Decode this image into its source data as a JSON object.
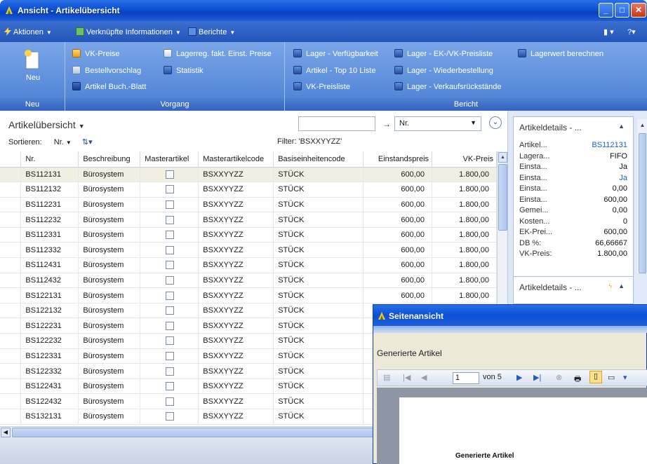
{
  "window": {
    "title": "Ansicht - Artikelübersicht",
    "minimize": "_",
    "maximize": "□",
    "close": "✕"
  },
  "commandbar": {
    "actions": "Aktionen",
    "related": "Verknüpfte Informationen",
    "reports": "Berichte"
  },
  "ribbon": {
    "groups": {
      "new": {
        "caption": "Neu",
        "items": {
          "new": "Neu"
        }
      },
      "process": {
        "caption": "Vorgang",
        "items": {
          "vk_preise": "VK-Preise",
          "bestellvorschlag": "Bestellvorschlag",
          "artikel_buch_blatt": "Artikel Buch.-Blatt",
          "lagerreg": "Lagerreg. fakt. Einst. Preise",
          "statistik": "Statistik"
        }
      },
      "report": {
        "caption": "Bericht",
        "items": {
          "lager_verfuegbarkeit": "Lager - Verfügbarkeit",
          "artikel_top10": "Artikel - Top 10 Liste",
          "vk_preisliste": "VK-Preisliste",
          "lager_ek_vk": "Lager - EK-/VK-Preisliste",
          "lager_wiederbestellung": "Lager - Wiederbestellung",
          "lager_verkaufsrueckstaende": "Lager - Verkaufsrückstände",
          "lagerwert": "Lagerwert berechnen"
        }
      }
    }
  },
  "list": {
    "title": "Artikelübersicht",
    "sort_label": "Sortieren:",
    "sort_value": "Nr.",
    "search_value": "",
    "search_field": "Nr.",
    "filter": "Filter: 'BSXXYYZZ'",
    "columns": [
      "Nr.",
      "Beschreibung",
      "Masterartikel",
      "Masterartikelcode",
      "Basiseinheitencode",
      "Einstandspreis",
      "VK-Preis"
    ],
    "rows": [
      [
        "BS112131",
        "Bürosystem",
        "",
        "BSXXYYZZ",
        "STÜCK",
        "600,00",
        "1.800,00"
      ],
      [
        "BS112132",
        "Bürosystem",
        "",
        "BSXXYYZZ",
        "STÜCK",
        "600,00",
        "1.800,00"
      ],
      [
        "BS112231",
        "Bürosystem",
        "",
        "BSXXYYZZ",
        "STÜCK",
        "600,00",
        "1.800,00"
      ],
      [
        "BS112232",
        "Bürosystem",
        "",
        "BSXXYYZZ",
        "STÜCK",
        "600,00",
        "1.800,00"
      ],
      [
        "BS112331",
        "Bürosystem",
        "",
        "BSXXYYZZ",
        "STÜCK",
        "600,00",
        "1.800,00"
      ],
      [
        "BS112332",
        "Bürosystem",
        "",
        "BSXXYYZZ",
        "STÜCK",
        "600,00",
        "1.800,00"
      ],
      [
        "BS112431",
        "Bürosystem",
        "",
        "BSXXYYZZ",
        "STÜCK",
        "600,00",
        "1.800,00"
      ],
      [
        "BS112432",
        "Bürosystem",
        "",
        "BSXXYYZZ",
        "STÜCK",
        "600,00",
        "1.800,00"
      ],
      [
        "BS122131",
        "Bürosystem",
        "",
        "BSXXYYZZ",
        "STÜCK",
        "600,00",
        "1.800,00"
      ],
      [
        "BS122132",
        "Bürosystem",
        "",
        "BSXXYYZZ",
        "STÜCK",
        "",
        ""
      ],
      [
        "BS122231",
        "Bürosystem",
        "",
        "BSXXYYZZ",
        "STÜCK",
        "",
        ""
      ],
      [
        "BS122232",
        "Bürosystem",
        "",
        "BSXXYYZZ",
        "STÜCK",
        "",
        ""
      ],
      [
        "BS122331",
        "Bürosystem",
        "",
        "BSXXYYZZ",
        "STÜCK",
        "",
        ""
      ],
      [
        "BS122332",
        "Bürosystem",
        "",
        "BSXXYYZZ",
        "STÜCK",
        "",
        ""
      ],
      [
        "BS122431",
        "Bürosystem",
        "",
        "BSXXYYZZ",
        "STÜCK",
        "",
        ""
      ],
      [
        "BS122432",
        "Bürosystem",
        "",
        "BSXXYYZZ",
        "STÜCK",
        "",
        ""
      ],
      [
        "BS132131",
        "Bürosystem",
        "",
        "BSXXYYZZ",
        "STÜCK",
        "",
        ""
      ]
    ]
  },
  "factbox1": {
    "title": "Artikeldetails - ...",
    "rows": [
      {
        "k": "Artikel...",
        "v": "BS112131",
        "link": true
      },
      {
        "k": "Lagera...",
        "v": "FIFO"
      },
      {
        "k": "Einsta...",
        "v": "Ja"
      },
      {
        "k": "Einsta...",
        "v": "Ja",
        "link": true
      },
      {
        "k": "Einsta...",
        "v": "0,00"
      },
      {
        "k": "Einsta...",
        "v": "600,00"
      },
      {
        "k": "Gemei...",
        "v": "0,00"
      },
      {
        "k": "Kosten...",
        "v": "0"
      },
      {
        "k": "EK-Prei...",
        "v": "600,00"
      },
      {
        "k": "DB %:",
        "v": "66,66667"
      },
      {
        "k": "VK-Preis:",
        "v": "1.800,00"
      }
    ]
  },
  "factbox2": {
    "title": "Artikeldetails - ..."
  },
  "preview": {
    "title": "Seitenansicht",
    "heading": "Generierte Artikel",
    "page_value": "1",
    "page_of": "von 5",
    "page_text": "Generierte Artikel"
  },
  "colors": {
    "titlebar": "#0a4fd6",
    "ribbon": "#4a7fd4",
    "selected_row": "#f1efe2",
    "link": "#1a5fc8"
  }
}
